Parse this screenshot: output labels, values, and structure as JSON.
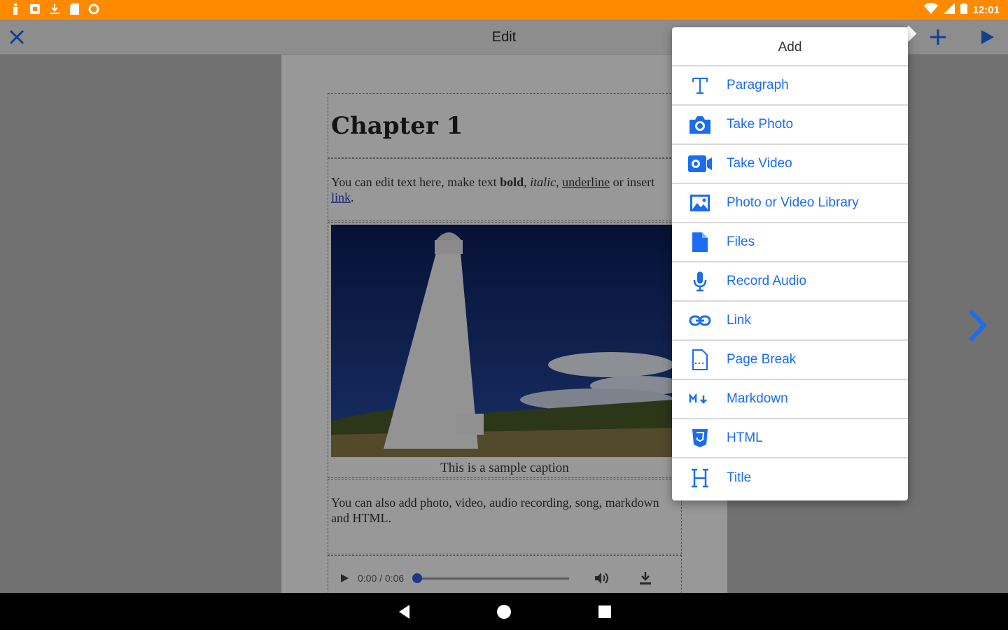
{
  "status_bar": {
    "time": "12:01",
    "background": "#ff8a00"
  },
  "app_bar": {
    "title": "Edit",
    "close_icon": "close-icon",
    "add_icon": "plus-icon",
    "play_icon": "play-icon"
  },
  "document": {
    "chapter_title": "Chapter 1",
    "para1_a": "You can edit text here, make text ",
    "para1_bold": "bold",
    "para1_sep1": ", ",
    "para1_italic": "italic",
    "para1_sep2": ", ",
    "para1_underline": "underline",
    "para1_b": " or insert ",
    "para1_link": "link",
    "para1_end": ".",
    "caption": "This is a sample caption",
    "para2": "You can also add photo, video, audio recording, song, markdown and HTML.",
    "audio_time": "0:00 / 0:06",
    "audio_progress": 0
  },
  "menu": {
    "title": "Add",
    "accent": "#1a6df0",
    "items": [
      {
        "label": "Paragraph",
        "icon": "text-icon"
      },
      {
        "label": "Take Photo",
        "icon": "camera-icon"
      },
      {
        "label": "Take Video",
        "icon": "videocam-icon"
      },
      {
        "label": "Photo or Video Library",
        "icon": "image-icon"
      },
      {
        "label": "Files",
        "icon": "file-icon"
      },
      {
        "label": "Record Audio",
        "icon": "mic-icon"
      },
      {
        "label": "Link",
        "icon": "link-icon"
      },
      {
        "label": "Page Break",
        "icon": "page-break-icon"
      },
      {
        "label": "Markdown",
        "icon": "markdown-icon"
      },
      {
        "label": "HTML",
        "icon": "html5-icon"
      },
      {
        "label": "Title",
        "icon": "heading-icon"
      }
    ]
  }
}
